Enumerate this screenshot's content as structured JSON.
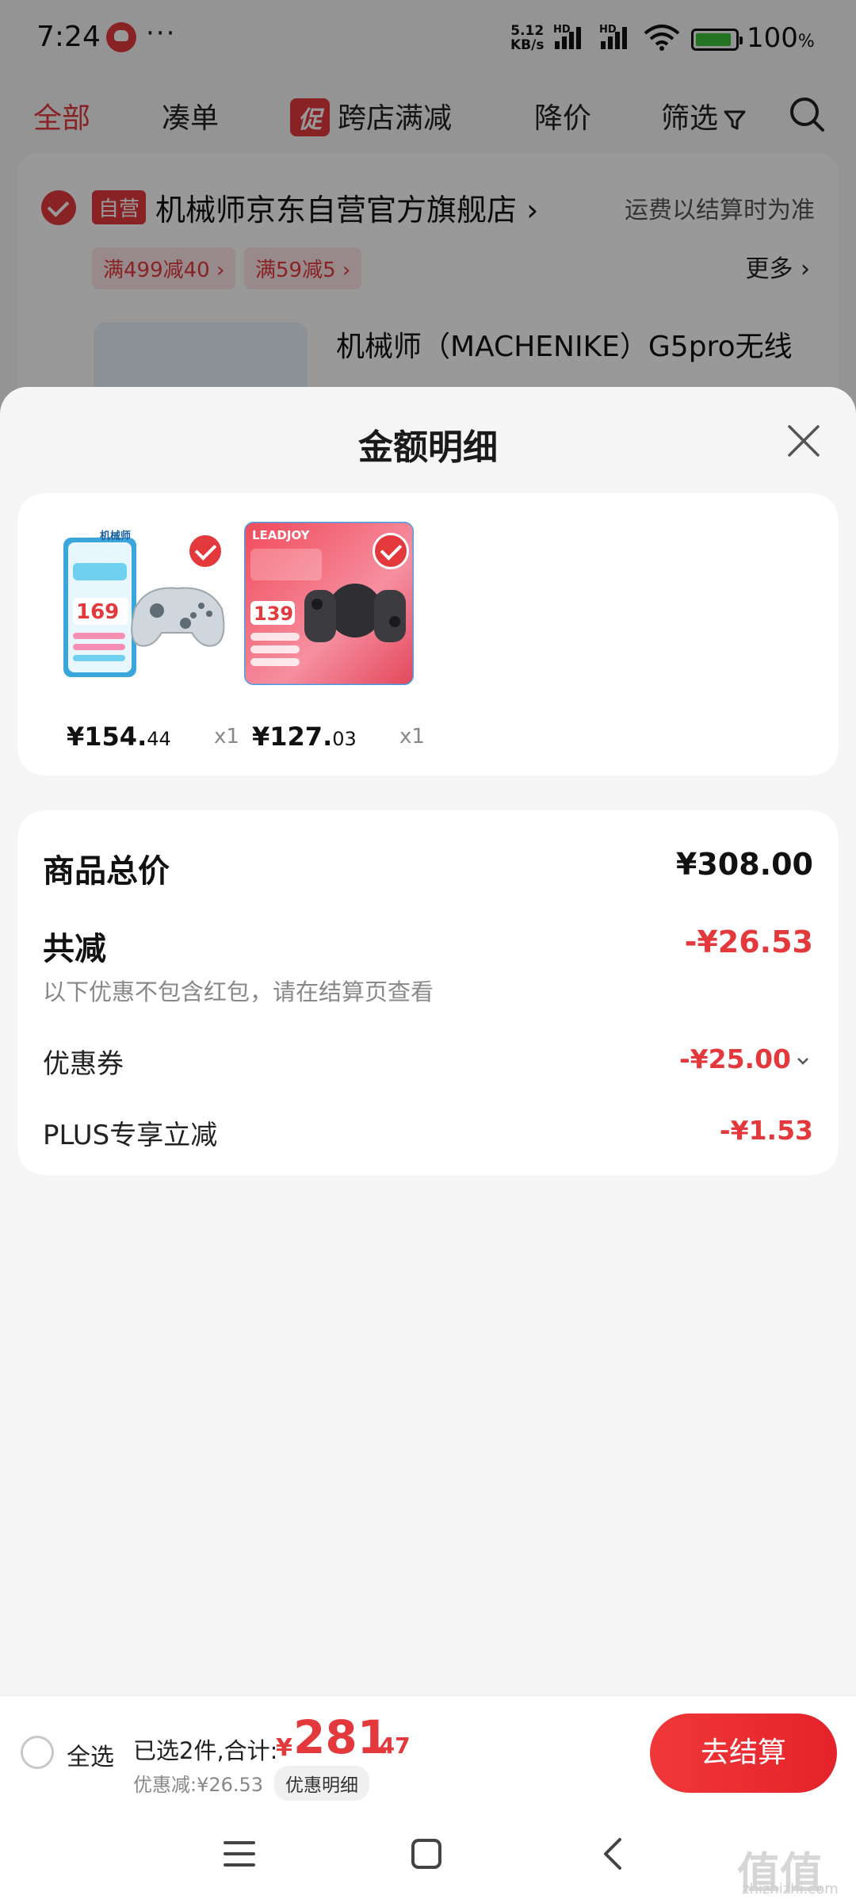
{
  "status_bar": {
    "time": "7:24",
    "more": "···",
    "net_speed_value": "5.12",
    "net_speed_unit": "KB/s",
    "hd1": "HD",
    "hd2": "HD",
    "battery_percent": "100",
    "battery_unit": "%"
  },
  "top_tabs": {
    "all": "全部",
    "bundle": "凑单",
    "promo_badge": "促",
    "cross_store": "跨店满减",
    "price_drop": "降价",
    "filter": "筛选"
  },
  "store": {
    "self_badge": "自营",
    "name": "机械师京东自营官方旗舰店",
    "shipping_note": "运费以结算时为准",
    "coupons": [
      "满499减40 ›",
      "满59减5 ›"
    ],
    "more": "更多 ›",
    "product_title": "机械师（MACHENIKE）G5pro无线"
  },
  "sheet": {
    "title": "金额明细",
    "items": [
      {
        "price_main": "¥154.",
        "price_dec": "44",
        "qty": "x1",
        "img_brand": "机械师",
        "img_promo": "169"
      },
      {
        "price_main": "¥127.",
        "price_dec": "03",
        "qty": "x1",
        "img_brand": "LEADJOY",
        "img_promo": "139"
      }
    ],
    "summary": {
      "total_label": "商品总价",
      "total_value": "¥308.00",
      "reduction_label": "共减",
      "reduction_value": "-¥26.53",
      "reduction_note": "以下优惠不包含红包，请在结算页查看",
      "coupon_label": "优惠券",
      "coupon_value": "-¥25.00",
      "plus_label": "PLUS专享立减",
      "plus_value": "-¥1.53"
    }
  },
  "checkout": {
    "select_all": "全选",
    "selected_summary": "已选2件,合计:",
    "currency": "¥",
    "total_main": "281",
    "total_dec": ".47",
    "discount_text": "优惠减:¥26.53",
    "discount_detail": "优惠明细",
    "checkout_button": "去结算"
  },
  "watermark": {
    "main": "值值值",
    "sub": "zhizhizhi.com"
  },
  "colors": {
    "accent": "#e4393c",
    "background": "#f5f5f5"
  }
}
